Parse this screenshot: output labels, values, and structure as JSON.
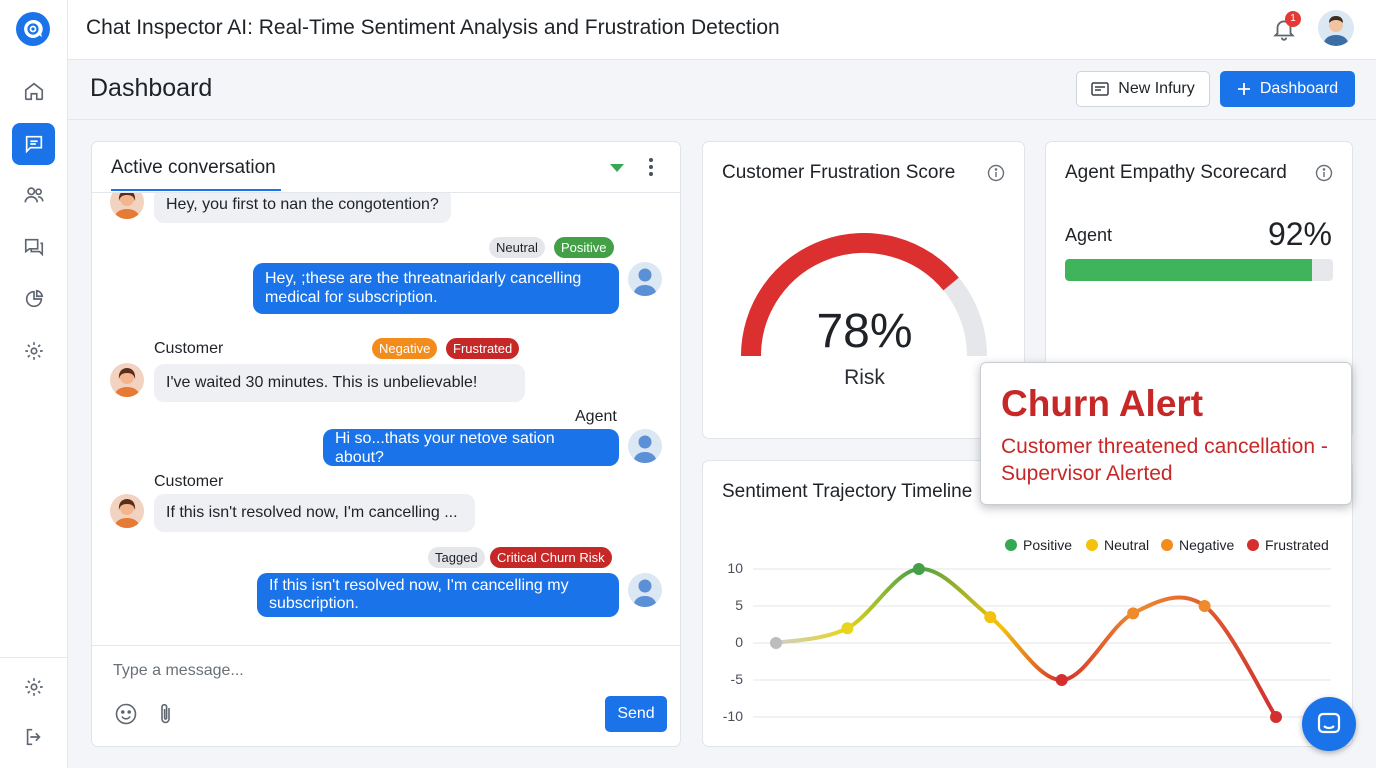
{
  "app": {
    "title": "Chat Inspector AI: Real-Time Sentiment Analysis and Frustration Detection",
    "notification_count": "1"
  },
  "sidebar": {
    "items": [
      {
        "icon": "home-icon",
        "active": false
      },
      {
        "icon": "chat-icon",
        "active": true
      },
      {
        "icon": "users-icon",
        "active": false
      },
      {
        "icon": "conversations-icon",
        "active": false
      },
      {
        "icon": "analytics-icon",
        "active": false
      },
      {
        "icon": "settings-icon",
        "active": false
      }
    ],
    "bottom": [
      {
        "icon": "settings-icon"
      },
      {
        "icon": "logout-icon"
      }
    ]
  },
  "header": {
    "page_title": "Dashboard",
    "new_button_label": "New Infury",
    "primary_button_label": "Dashboard"
  },
  "conversation": {
    "title": "Active conversation",
    "messages": {
      "m1": "Hey, you first to nan the congotention?",
      "m2": "Hey, ;these are the threatnaridarly cancelling medical for subscription.",
      "m3": "I've waited 30 minutes. This is unbelievable!",
      "m4": "Hi so...thats your netove sation about?",
      "m5": "If this isn't resolved now, I'm cancelling ...",
      "m6": "If this isn't resolved now, I'm cancelling my subscription."
    },
    "speakers": {
      "s1": "Customer",
      "s2": "Agent",
      "s3": "Customer"
    },
    "tags": {
      "t1": "Neutral",
      "t2": "Positive",
      "t3": "Negative",
      "t4": "Frustrated",
      "t5": "Tagged",
      "t6": "Critical Churn Risk"
    },
    "composer_placeholder": "Type a message...",
    "send_label": "Send"
  },
  "frustration": {
    "title": "Customer Frustration Score",
    "value": "78%",
    "value_fraction": 0.78,
    "label": "Risk"
  },
  "empathy": {
    "title": "Agent Empathy Scorecard",
    "agent_label": "Agent",
    "value": "92%",
    "value_fraction": 0.92
  },
  "alert": {
    "title": "Churn Alert",
    "body": "Customer threatened cancellation - Supervisor Alerted"
  },
  "timeline": {
    "title": "Sentiment Trajectory Timeline"
  },
  "colors": {
    "accent": "#1a73e8",
    "positive": "#34a853",
    "neutral": "#f4c20d",
    "negative": "#f28c1c",
    "frustrated": "#d32f2f"
  },
  "chart_data": {
    "type": "line",
    "title": "Sentiment Trajectory Timeline",
    "legend": [
      "Positive",
      "Neutral",
      "Negative",
      "Frustrated"
    ],
    "legend_position": "top-right",
    "yticks": [
      "10",
      "5",
      "0",
      "-5",
      "-10"
    ],
    "ylim": [
      -10,
      10
    ],
    "grid": true,
    "series": [
      {
        "values": [
          0,
          2,
          10,
          3.5,
          -5,
          4,
          5,
          -10
        ],
        "point_colors": [
          "#bdbdbd",
          "#e8d41a",
          "#43a047",
          "#f4c20d",
          "#d32f2f",
          "#ef8a2d",
          "#ef8a2d",
          "#d32f2f"
        ]
      }
    ]
  }
}
